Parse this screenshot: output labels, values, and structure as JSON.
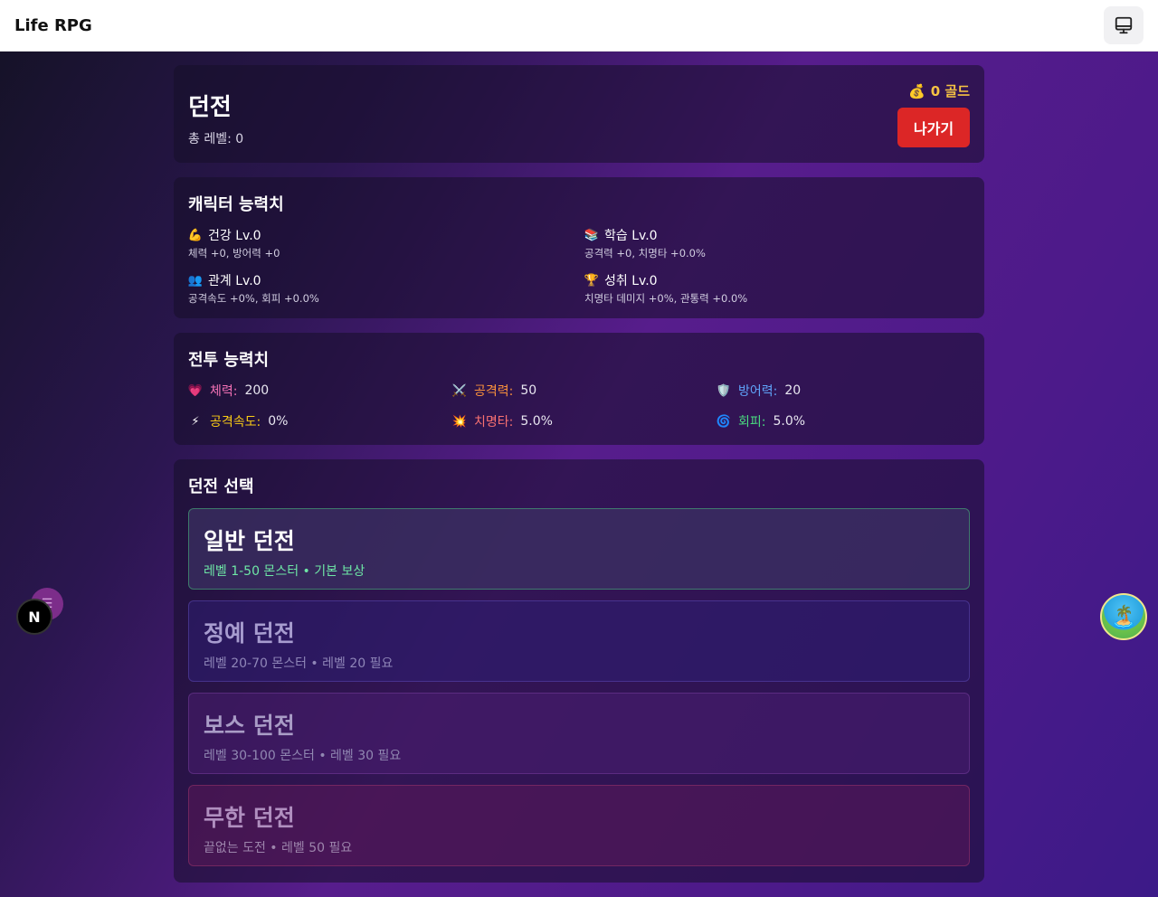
{
  "app": {
    "title": "Life RPG"
  },
  "header": {
    "title": "던전",
    "total_level_label": "총 레벨: 0",
    "gold": "0 골드",
    "exit_label": "나가기"
  },
  "character": {
    "title": "캐릭터 능력치",
    "items": [
      {
        "name": "건강 Lv.0",
        "desc": "체력 +0, 방어력 +0",
        "icon": "flexed-biceps-icon"
      },
      {
        "name": "학습 Lv.0",
        "desc": "공격력 +0, 치명타 +0.0%",
        "icon": "books-icon"
      },
      {
        "name": "관계 Lv.0",
        "desc": "공격속도 +0%, 회피 +0.0%",
        "icon": "people-icon"
      },
      {
        "name": "성취 Lv.0",
        "desc": "치명타 데미지 +0%, 관통력 +0.0%",
        "icon": "trophy-icon"
      }
    ]
  },
  "battle": {
    "title": "전투 능력치",
    "stats": [
      {
        "label": "체력:",
        "value": "200",
        "color": "#f472b6"
      },
      {
        "label": "공격력:",
        "value": "50",
        "color": "#fb923c"
      },
      {
        "label": "방어력:",
        "value": "20",
        "color": "#60a5fa"
      },
      {
        "label": "공격속도:",
        "value": "0%",
        "color": "#facc15"
      },
      {
        "label": "치명타:",
        "value": "5.0%",
        "color": "#f87171"
      },
      {
        "label": "회피:",
        "value": "5.0%",
        "color": "#4ade80"
      }
    ]
  },
  "dungeon_select": {
    "title": "던전 선택",
    "items": [
      {
        "name": "일반 던전",
        "desc": "레벨 1-50 몬스터 • 기본 보상"
      },
      {
        "name": "정예 던전",
        "desc": "레벨 20-70 몬스터 • 레벨 20 필요"
      },
      {
        "name": "보스 던전",
        "desc": "레벨 30-100 몬스터 • 레벨 30 필요"
      },
      {
        "name": "무한 던전",
        "desc": "끝없는 도전 • 레벨 50 필요"
      }
    ]
  },
  "floating": {
    "n_logo": "N"
  }
}
